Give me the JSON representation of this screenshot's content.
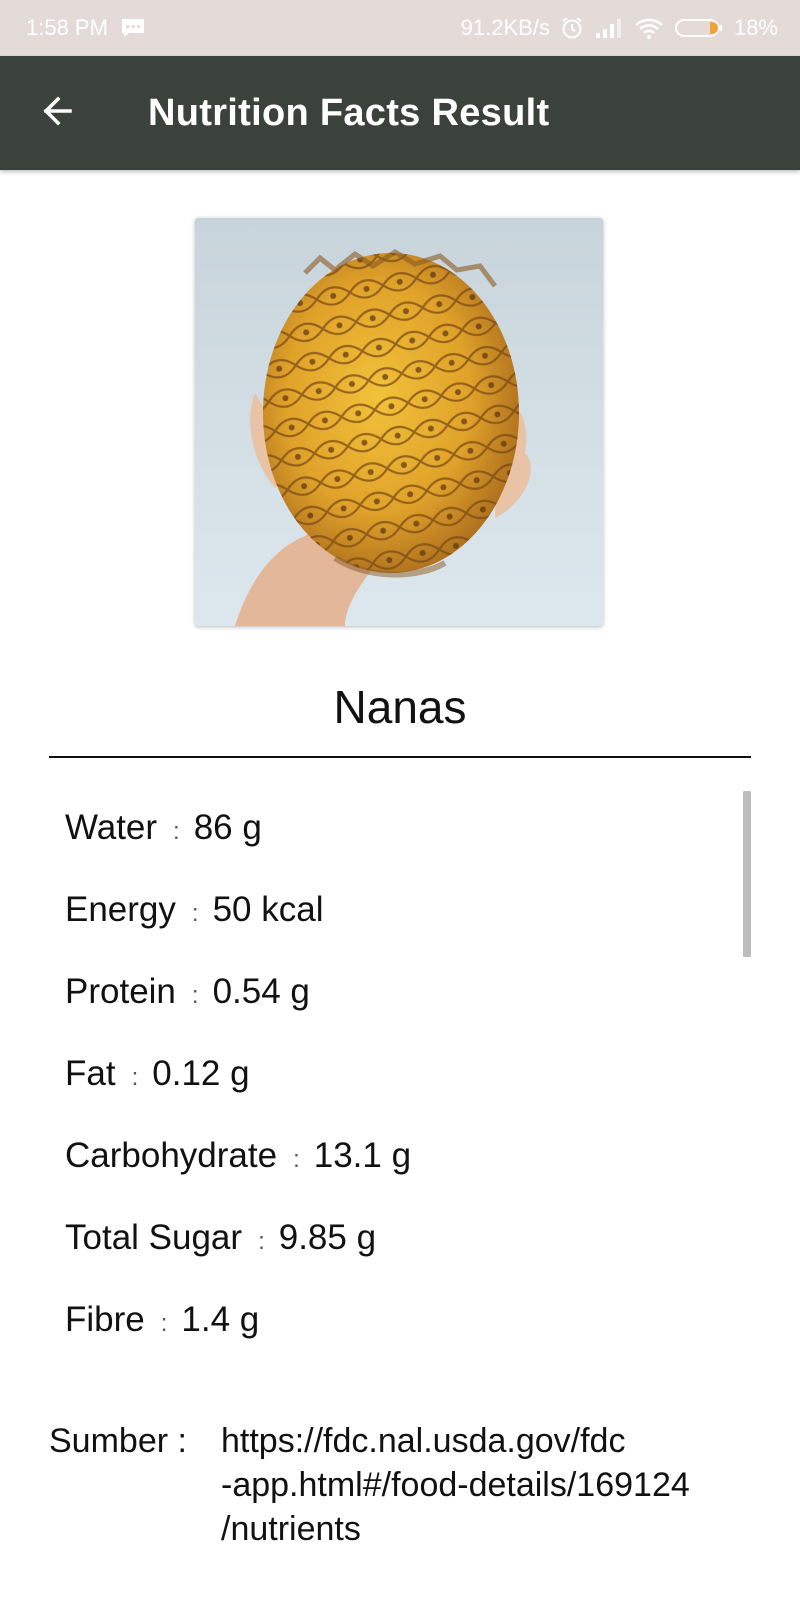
{
  "status_bar": {
    "time": "1:58 PM",
    "network_speed": "91.2KB/s",
    "battery": "18%",
    "icons": [
      "message-icon",
      "alarm-icon",
      "signal-icon",
      "wifi-icon",
      "battery-icon"
    ]
  },
  "app_bar": {
    "title": "Nutrition Facts Result",
    "back_icon": "arrow-left-icon",
    "color": "#3a423b"
  },
  "food": {
    "name": "Nanas",
    "image": "pineapple-photo"
  },
  "nutrients": [
    {
      "label": "Water",
      "separator": ":",
      "value": "86 g"
    },
    {
      "label": "Energy",
      "separator": ":",
      "value": "50 kcal"
    },
    {
      "label": "Protein",
      "separator": ":",
      "value": "0.54 g"
    },
    {
      "label": "Fat",
      "separator": ":",
      "value": "0.12 g"
    },
    {
      "label": "Carbohydrate",
      "separator": ":",
      "value": "13.1 g"
    },
    {
      "label": "Total Sugar",
      "separator": ":",
      "value": "9.85 g"
    },
    {
      "label": "Fibre",
      "separator": ":",
      "value": "1.4 g"
    }
  ],
  "source": {
    "label": "Sumber :",
    "url_lines": [
      "https://fdc.nal.usda.gov/fdc",
      "-app.html#/food-details/169124",
      "/nutrients"
    ]
  }
}
